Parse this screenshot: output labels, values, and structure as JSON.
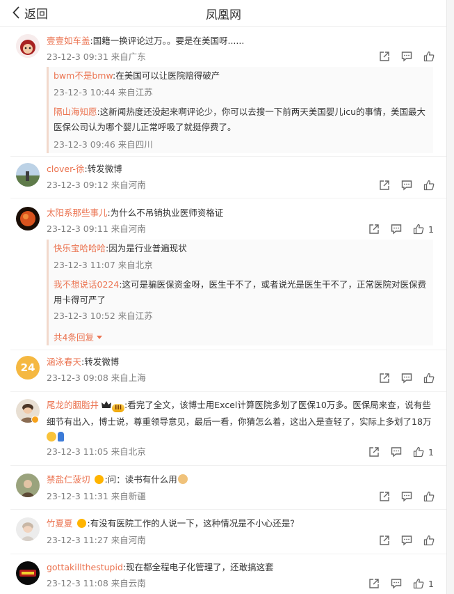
{
  "header": {
    "back_label": "返回",
    "title": "凤凰网"
  },
  "comments": [
    {
      "user": "壹壹如车盖",
      "text": ":国籍一换评论过万。。要是在美国呀......",
      "meta": "23-12-3 09:31 来自广东",
      "likes": "",
      "replies": [
        {
          "user": "bwm不是bmw",
          "text": ":在美国可以让医院赔得破产",
          "meta": "23-12-3 10:44 来自江苏"
        },
        {
          "user": "隔山海知愿",
          "text": ":这新闻热度还没起来啊评论少，你可以去搜一下前两天美国婴儿icu的事情，美国最大医保公司认为哪个婴儿正常呼吸了就挺停费了。",
          "meta": "23-12-3 09:46 来自四川"
        }
      ]
    },
    {
      "user": "clover-徐",
      "text": ":转发微博",
      "meta": "23-12-3 09:12 来自河南",
      "likes": ""
    },
    {
      "user": "太阳系那些事儿",
      "text": ":为什么不吊销执业医师资格证",
      "meta": "23-12-3 09:11 来自河南",
      "likes": "1",
      "replies": [
        {
          "user": "快乐宝哈哈哈",
          "text": ":因为是行业普遍现状",
          "meta": "23-12-3 11:07 来自北京"
        },
        {
          "user": "我不想说话0224",
          "text": ":这可是骗医保资金呀，医生干不了，或者说光是医生干不了，正常医院对医保费用卡得可严了",
          "meta": "23-12-3 10:52 来自江苏"
        }
      ],
      "more_replies": "共4条回复"
    },
    {
      "user": "涵泳春天",
      "text": ":转发微博",
      "meta": "23-12-3 09:08 来自上海",
      "likes": "",
      "avatar_text": "24"
    },
    {
      "user": "尾龙的胭脂井",
      "badge": "III",
      "text": ":看完了全文，该博士用Excel计算医院多划了医保10万多。医保局来查，说有些细节有出入，博士说，尊重领导意见，最后一看，你猜怎么着，这出入是查轻了，实际上多划了18万",
      "meta": "23-12-3 11:05 来自北京",
      "likes": "1"
    },
    {
      "user": "禁盐仁菠切",
      "text": ":问：读书有什么用",
      "meta": "23-12-3 11:31 来自新疆",
      "likes": ""
    },
    {
      "user": "竹夏夏",
      "text": ":有没有医院工作的人说一下，这种情况是不小心还是？",
      "meta": "23-12-3 11:27 来自河南",
      "likes": ""
    },
    {
      "user": "gottakillthestupid",
      "text": ":现在都全程电子化管理了，还敢搞这套",
      "meta": "23-12-3 11:08 来自云南",
      "likes": "1"
    }
  ],
  "icons": {
    "share": "share-icon",
    "comment": "comment-icon",
    "like": "thumbs-up-icon",
    "back": "chevron-left-icon",
    "more": "caret-down-icon"
  },
  "colors": {
    "username": "#eb7350",
    "meta": "#808080",
    "reply_bg": "#fafafa"
  }
}
